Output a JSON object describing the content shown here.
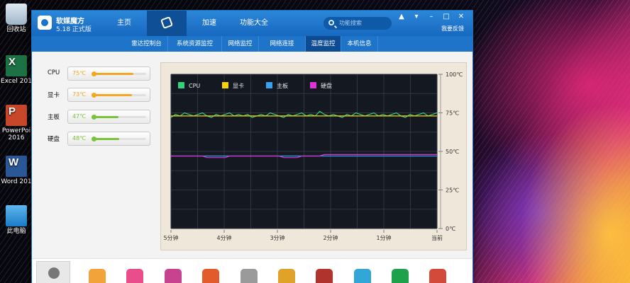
{
  "desktop": {
    "icons": [
      {
        "label": "回收站",
        "icon": "recycle-bin-icon"
      },
      {
        "label": "Excel 201",
        "icon": "excel-icon"
      },
      {
        "label": "PowerPoi 2016",
        "icon": "powerpoint-icon"
      },
      {
        "label": "Word 201",
        "icon": "word-icon"
      },
      {
        "label": "此电脑",
        "icon": "this-pc-icon"
      }
    ]
  },
  "app": {
    "name": "软媒魔方",
    "version": "5.18 正式版",
    "nav": [
      "主页",
      "",
      "加速",
      "功能大全"
    ],
    "active_nav_icon": "toolbox-icon",
    "search_placeholder": "功能搜索",
    "feedback": "我要反馈",
    "window_controls": [
      "shirt-icon",
      "menu-icon",
      "minimize-icon",
      "restore-icon",
      "close-icon"
    ],
    "subnav": [
      "雷达控制台",
      "系统资源监控",
      "网络监控",
      "网络连接",
      "温度监控",
      "本机信息"
    ],
    "active_subnav": "温度监控"
  },
  "sensors": [
    {
      "label": "CPU",
      "temp": "75℃",
      "value": 75,
      "color": "#f5a623"
    },
    {
      "label": "显卡",
      "temp": "73℃",
      "value": 73,
      "color": "#f5a623"
    },
    {
      "label": "主板",
      "temp": "47℃",
      "value": 47,
      "color": "#7cc13a"
    },
    {
      "label": "硬盘",
      "temp": "48℃",
      "value": 48,
      "color": "#7cc13a"
    }
  ],
  "chart_data": {
    "type": "line",
    "x_ticks": [
      "5分钟",
      "4分钟",
      "3分钟",
      "2分钟",
      "1分钟",
      "当前"
    ],
    "y_ticks": [
      "100℃",
      "75℃",
      "50℃",
      "25℃",
      "0℃"
    ],
    "ylim": [
      0,
      100
    ],
    "legend_placement": "top-left",
    "grid": true,
    "series": [
      {
        "name": "CPU",
        "color": "#34d27a",
        "values": [
          72,
          74,
          73,
          75,
          74,
          73,
          74,
          75,
          73,
          72,
          74,
          73,
          74,
          75,
          73,
          74,
          73,
          74,
          72,
          73,
          74,
          73,
          75,
          74,
          73,
          72,
          74,
          73,
          74,
          75,
          73,
          74,
          73,
          76,
          74,
          73,
          74,
          73,
          72,
          74,
          73,
          75,
          74,
          73,
          74,
          75,
          73,
          74,
          73,
          74,
          75,
          73,
          72,
          74,
          73,
          74,
          75,
          73,
          74,
          75
        ]
      },
      {
        "name": "显卡",
        "color": "#f5d20d",
        "values": [
          73,
          73,
          73,
          73,
          73,
          73,
          73,
          73,
          73,
          73,
          73,
          73,
          73,
          73,
          73,
          73,
          73,
          73,
          73,
          73,
          73,
          73,
          73,
          73,
          73,
          73,
          73,
          73,
          73,
          73,
          73,
          73,
          73,
          73,
          73,
          73,
          73,
          73,
          73,
          73,
          73,
          73,
          73,
          73,
          73,
          73,
          73,
          73,
          73,
          73,
          73,
          73,
          73,
          73,
          73,
          73,
          73,
          73,
          73,
          73
        ]
      },
      {
        "name": "主板",
        "color": "#3aa0f0",
        "values": [
          47,
          47,
          47,
          47,
          47,
          47,
          47,
          47,
          47,
          47,
          47,
          47,
          47,
          47,
          47,
          47,
          47,
          47,
          47,
          47,
          47,
          47,
          47,
          47,
          47,
          47,
          47,
          47,
          47,
          47,
          47,
          47,
          47,
          47,
          47,
          47,
          47,
          47,
          47,
          47,
          47,
          47,
          47,
          47,
          47,
          47,
          47,
          47,
          47,
          47,
          47,
          47,
          47,
          47,
          47,
          47,
          47,
          47,
          47,
          47
        ]
      },
      {
        "name": "硬盘",
        "color": "#e032d8",
        "values": [
          47,
          47,
          47,
          47,
          47,
          47,
          47,
          47,
          46,
          46,
          46,
          46,
          46,
          47,
          47,
          47,
          47,
          47,
          47,
          47,
          47,
          47,
          47,
          47,
          47,
          46,
          46,
          46,
          46,
          47,
          47,
          47,
          47,
          47,
          48,
          48,
          48,
          48,
          48,
          48,
          48,
          48,
          48,
          48,
          48,
          48,
          48,
          48,
          48,
          48,
          48,
          48,
          48,
          48,
          48,
          48,
          48,
          48,
          48,
          48
        ]
      }
    ]
  },
  "toolbar": {
    "items": [
      "user-icon",
      "cleaner-icon",
      "app-store-icon",
      "pen-icon",
      "rocket-icon",
      "wrench-icon",
      "shield-icon",
      "winrar-icon",
      "boat-icon",
      "dns-icon",
      "disk-icon"
    ],
    "colors": [
      "#888888",
      "#f2a43a",
      "#e94d8a",
      "#c7428f",
      "#e35a2b",
      "#9a9a9a",
      "#e0a32a",
      "#b1332e",
      "#33a6d8",
      "#1da14a",
      "#d44a3a"
    ]
  }
}
